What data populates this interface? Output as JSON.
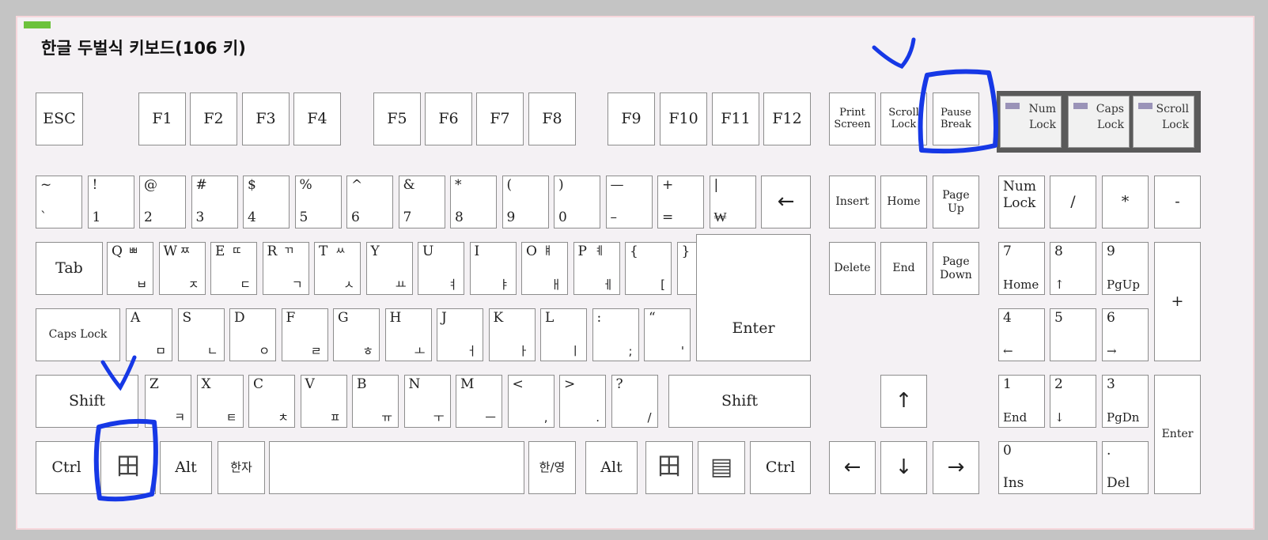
{
  "title": "한글 두벌식 키보드(106 키)",
  "colors": {
    "key_face": "#ffffff",
    "key_border": "#8d8d8d",
    "annotation": "#1638e6",
    "led_frame": "#5a5a5a"
  },
  "icons": {
    "windows_key": "windows-logo-icon",
    "menu_key": "application-menu-icon"
  },
  "function_row": [
    "ESC",
    "F1",
    "F2",
    "F3",
    "F4",
    "F5",
    "F6",
    "F7",
    "F8",
    "F9",
    "F10",
    "F11",
    "F12"
  ],
  "system_keys": [
    {
      "id": "print-screen",
      "label": "Print\nScreen"
    },
    {
      "id": "scroll-lock",
      "label": "Scroll\nLock"
    },
    {
      "id": "pause-break",
      "label": "Pause\nBreak"
    }
  ],
  "indicators": [
    {
      "id": "num",
      "label": "Num\nLock"
    },
    {
      "id": "caps",
      "label": "Caps\nLock"
    },
    {
      "id": "scroll",
      "label": "Scroll\nLock"
    }
  ],
  "number_row": [
    {
      "top": "~",
      "bottom": "`"
    },
    {
      "top": "!",
      "bottom": "1"
    },
    {
      "top": "@",
      "bottom": "2"
    },
    {
      "top": "#",
      "bottom": "3"
    },
    {
      "top": "$",
      "bottom": "4"
    },
    {
      "top": "%",
      "bottom": "5"
    },
    {
      "top": "^",
      "bottom": "6"
    },
    {
      "top": "&",
      "bottom": "7"
    },
    {
      "top": "*",
      "bottom": "8"
    },
    {
      "top": "(",
      "bottom": "9"
    },
    {
      "top": ")",
      "bottom": "0"
    },
    {
      "top": "—",
      "bottom": "–"
    },
    {
      "top": "+",
      "bottom": "="
    },
    {
      "top": "|",
      "bottom": "₩"
    }
  ],
  "backspace": "←",
  "tab": "Tab",
  "row_q": [
    {
      "en": "Q",
      "ko_shift": "ㅃ",
      "ko": "ㅂ"
    },
    {
      "en": "W",
      "ko_shift": "ㅉ",
      "ko": "ㅈ"
    },
    {
      "en": "E",
      "ko_shift": "ㄸ",
      "ko": "ㄷ"
    },
    {
      "en": "R",
      "ko_shift": "ㄲ",
      "ko": "ㄱ"
    },
    {
      "en": "T",
      "ko_shift": "ㅆ",
      "ko": "ㅅ"
    },
    {
      "en": "Y",
      "ko_shift": "",
      "ko": "ㅛ"
    },
    {
      "en": "U",
      "ko_shift": "",
      "ko": "ㅕ"
    },
    {
      "en": "I",
      "ko_shift": "",
      "ko": "ㅑ"
    },
    {
      "en": "O",
      "ko_shift": "ㅒ",
      "ko": "ㅐ"
    },
    {
      "en": "P",
      "ko_shift": "ㅖ",
      "ko": "ㅔ"
    },
    {
      "en": "{",
      "ko_shift": "",
      "ko": "["
    },
    {
      "en": "}",
      "ko_shift": "",
      "ko": "]"
    }
  ],
  "caps_lock": "Caps Lock",
  "row_a": [
    {
      "en": "A",
      "ko": "ㅁ"
    },
    {
      "en": "S",
      "ko": "ㄴ"
    },
    {
      "en": "D",
      "ko": "ㅇ"
    },
    {
      "en": "F",
      "ko": "ㄹ"
    },
    {
      "en": "G",
      "ko": "ㅎ"
    },
    {
      "en": "H",
      "ko": "ㅗ"
    },
    {
      "en": "J",
      "ko": "ㅓ"
    },
    {
      "en": "K",
      "ko": "ㅏ"
    },
    {
      "en": "L",
      "ko": "ㅣ"
    },
    {
      "en": ":",
      "ko": ";"
    },
    {
      "en": "“",
      "ko": "'"
    }
  ],
  "enter": "Enter",
  "shift": "Shift",
  "row_z": [
    {
      "en": "Z",
      "ko": "ㅋ"
    },
    {
      "en": "X",
      "ko": "ㅌ"
    },
    {
      "en": "C",
      "ko": "ㅊ"
    },
    {
      "en": "V",
      "ko": "ㅍ"
    },
    {
      "en": "B",
      "ko": "ㅠ"
    },
    {
      "en": "N",
      "ko": "ㅜ"
    },
    {
      "en": "M",
      "ko": "ㅡ"
    },
    {
      "en": "<",
      "ko": ","
    },
    {
      "en": ">",
      "ko": "."
    },
    {
      "en": "?",
      "ko": "/"
    }
  ],
  "bottom": {
    "ctrl": "Ctrl",
    "alt": "Alt",
    "hanja": "한자",
    "hanyoung": "한/영"
  },
  "nav": {
    "insert": "Insert",
    "home": "Home",
    "page_up": "Page\nUp",
    "delete": "Delete",
    "end": "End",
    "page_down": "Page\nDown"
  },
  "arrows": {
    "up": "↑",
    "down": "↓",
    "left": "←",
    "right": "→"
  },
  "numpad": {
    "numlock": "Num\nLock",
    "divide": "/",
    "multiply": "*",
    "minus": "-",
    "plus": "+",
    "enter": "Enter",
    "n7": {
      "main": "7",
      "sub": "Home"
    },
    "n8": {
      "main": "8",
      "sub": "↑"
    },
    "n9": {
      "main": "9",
      "sub": "PgUp"
    },
    "n4": {
      "main": "4",
      "sub": "←"
    },
    "n5": {
      "main": "5",
      "sub": ""
    },
    "n6": {
      "main": "6",
      "sub": "→"
    },
    "n1": {
      "main": "1",
      "sub": "End"
    },
    "n2": {
      "main": "2",
      "sub": "↓"
    },
    "n3": {
      "main": "3",
      "sub": "PgDn"
    },
    "n0": {
      "main": "0",
      "sub": "Ins"
    },
    "dot": {
      "main": ".",
      "sub": "Del"
    }
  }
}
